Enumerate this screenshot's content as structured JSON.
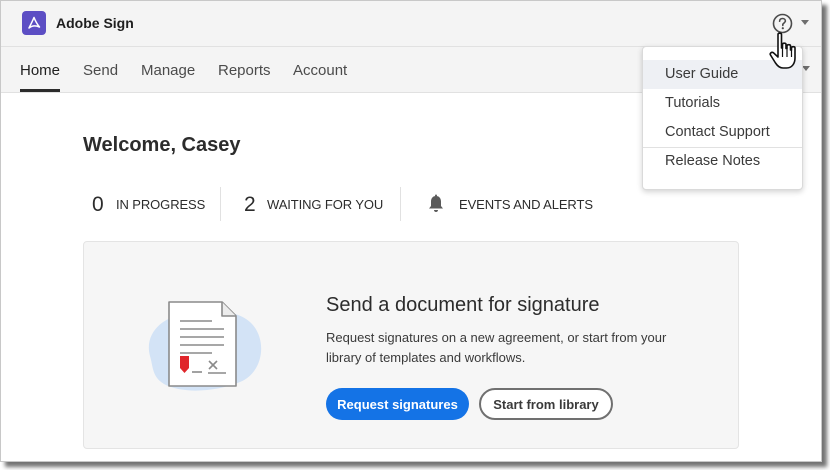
{
  "app": {
    "title": "Adobe Sign",
    "brand_color": "#5c4ec4"
  },
  "nav": {
    "tabs": [
      {
        "label": "Home",
        "active": true
      },
      {
        "label": "Send",
        "active": false
      },
      {
        "label": "Manage",
        "active": false
      },
      {
        "label": "Reports",
        "active": false
      },
      {
        "label": "Account",
        "active": false
      }
    ]
  },
  "help_menu": {
    "icon": "help-circle-icon",
    "items": [
      "User Guide",
      "Tutorials",
      "Contact Support",
      "Release Notes"
    ],
    "hovered": "User Guide"
  },
  "main": {
    "welcome": "Welcome, Casey",
    "stats": [
      {
        "count": "0",
        "label": "IN PROGRESS"
      },
      {
        "count": "2",
        "label": "WAITING FOR YOU"
      }
    ],
    "events_label": "EVENTS AND ALERTS",
    "card": {
      "title": "Send a document for signature",
      "description": "Request signatures on a new agreement, or start from your library of templates and workflows.",
      "primary_button": "Request signatures",
      "secondary_button": "Start from library"
    }
  },
  "colors": {
    "accent": "#1473e6",
    "signature_flag": "#e0262b"
  }
}
